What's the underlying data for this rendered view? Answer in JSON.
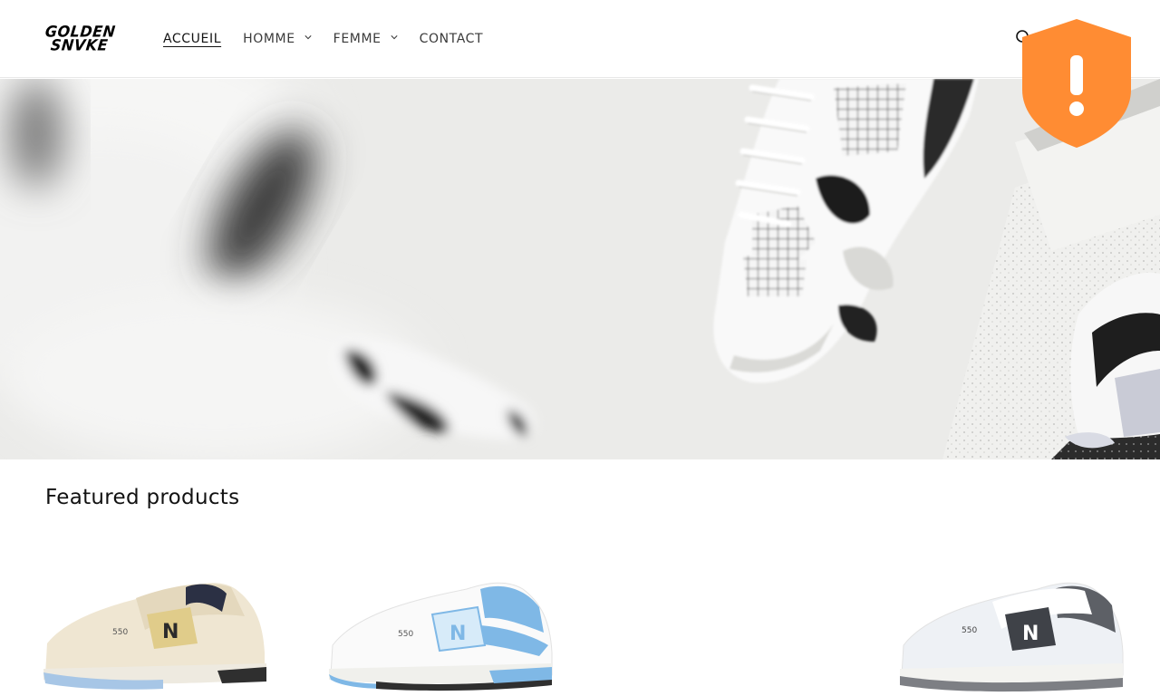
{
  "brand": {
    "logo_line1": "GOLDEN",
    "logo_line2": "SNVKE"
  },
  "nav": {
    "items": [
      {
        "label": "ACCUEIL",
        "active": true,
        "has_dropdown": false
      },
      {
        "label": "HOMME",
        "active": false,
        "has_dropdown": true
      },
      {
        "label": "FEMME",
        "active": false,
        "has_dropdown": true
      },
      {
        "label": "CONTACT",
        "active": false,
        "has_dropdown": false
      }
    ]
  },
  "icons": {
    "search": "search-icon",
    "dropdown": "chevron-down-icon",
    "security_badge": "shield-alert-icon"
  },
  "colors": {
    "badge": "#ff8c33",
    "text": "#121212",
    "background": "#ffffff"
  },
  "featured": {
    "title": "Featured products",
    "products": [
      {
        "colorway": "cream",
        "model_text": "550"
      },
      {
        "colorway": "white-blue",
        "model_text": "550"
      },
      {
        "colorway": "empty"
      },
      {
        "colorway": "white-grey",
        "model_text": "550"
      }
    ]
  }
}
